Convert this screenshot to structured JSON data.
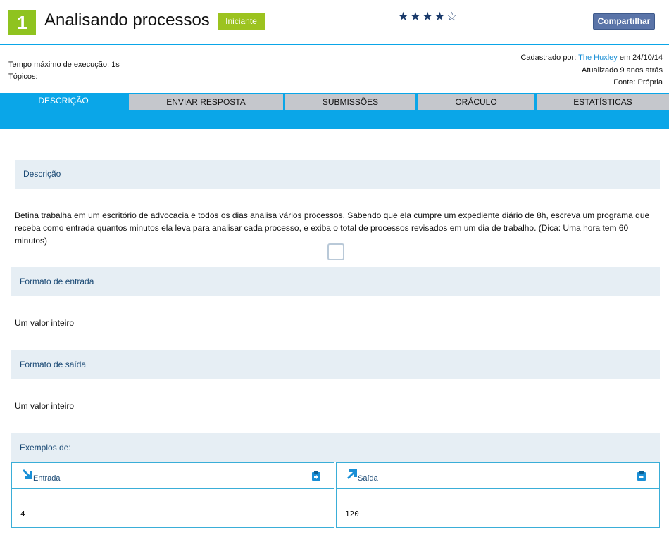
{
  "header": {
    "number": "1",
    "title": "Analisando processos",
    "level": "Iniciante",
    "rating_stars": "★★★★☆",
    "share_label": "Compartilhar"
  },
  "meta": {
    "exec_time": "Tempo máximo de execução: 1s",
    "topics": "Tópicos:",
    "registered_prefix": "Cadastrado por: ",
    "registered_by": "The Huxley",
    "registered_date": " em 24/10/14",
    "updated": "Atualizado 9 anos atrás",
    "source": "Fonte: Própria"
  },
  "tabs": [
    {
      "label": "DESCRIÇÃO",
      "active": true
    },
    {
      "label": "ENVIAR RESPOSTA",
      "active": false
    },
    {
      "label": "SUBMISSÕES",
      "active": false
    },
    {
      "label": "ORÁCULO",
      "active": false
    },
    {
      "label": "ESTATÍSTICAS",
      "active": false
    }
  ],
  "description": {
    "heading": "Descrição",
    "text": "Betina trabalha em um escritório de advocacia e todos os dias analisa vários processos. Sabendo que ela cumpre um expediente diário de 8h, escreva um programa que receba como entrada quantos minutos ela leva para analisar cada processo, e exiba o total de processos revisados em um dia de trabalho. (Dica: Uma hora tem 60 minutos)"
  },
  "input_format": {
    "heading": "Formato de entrada",
    "text": "Um valor inteiro"
  },
  "output_format": {
    "heading": "Formato de saída",
    "text": "Um valor inteiro"
  },
  "examples": {
    "heading": "Exemplos de:",
    "input_label": "Entrada",
    "output_label": "Saída",
    "input_value": "4",
    "output_value": "120"
  },
  "colors": {
    "accent": "#0aa6e8",
    "badge_green": "#8fc31f",
    "section_bg": "#e6eef4",
    "section_text": "#1b4a75",
    "share_button": "#5a74a8"
  }
}
